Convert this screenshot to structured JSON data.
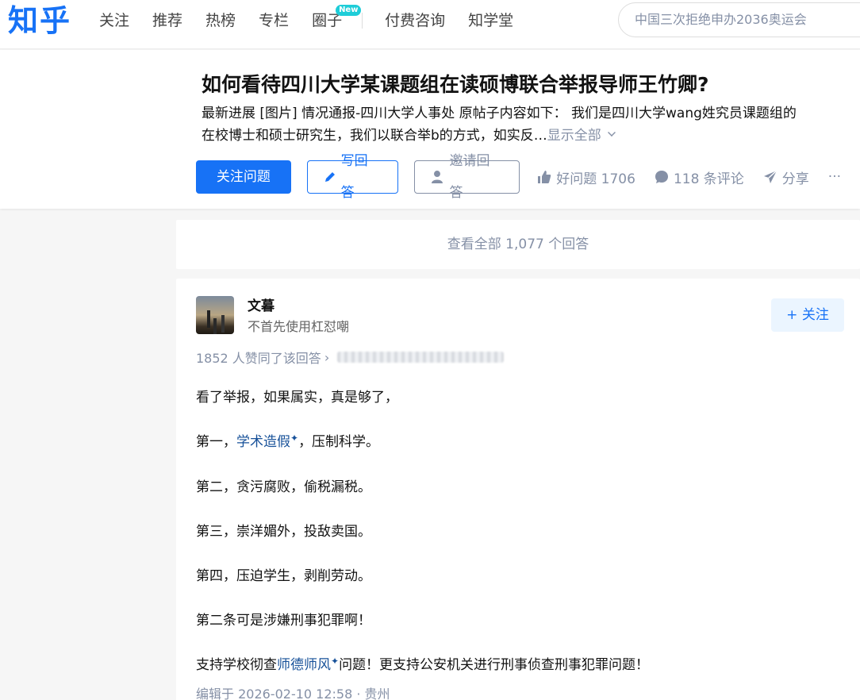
{
  "nav": {
    "logo": "知乎",
    "items": [
      "关注",
      "推荐",
      "热榜",
      "专栏",
      "圈子"
    ],
    "badge": "New",
    "items_right": [
      "付费咨询",
      "知学堂"
    ]
  },
  "search": {
    "placeholder": "中国三次拒绝申办2036奥运会"
  },
  "question": {
    "title": "如何看待四川大学某课题组在读硕博联合举报导师王竹卿?",
    "desc_line1": "最新进展 [图片] 情况通报-四川大学人事处 原帖子内容如下： 我们是四川大学wang姓究员课题组的",
    "desc_line2": "在校博士和硕士研究生，我们以联合举b的方式，如实反…",
    "show_all": "显示全部",
    "follow_label": "关注问题",
    "write_label": "写回答",
    "invite_label": "邀请回答",
    "good_label": "好问题 1706",
    "comments_label": "118 条评论",
    "share_label": "分享",
    "more_label": "···"
  },
  "view_all": "查看全部 1,077 个回答",
  "answer": {
    "author": "文暮",
    "bio": "不首先使用杠怼嘲",
    "follow_label": "+ 关注",
    "votes": "1852 人赞同了该回答",
    "paragraphs": {
      "p1": "看了举报，如果属实，真是够了，",
      "p2a": "第一，",
      "p2k": "学术造假",
      "p2b": "，压制科学。",
      "p3": "第二，贪污腐败，偷税漏税。",
      "p4": "第三，崇洋媚外，投敌卖国。",
      "p5": "第四，压迫学生，剥削劳动。",
      "p6": "第二条可是涉嫌刑事犯罪啊！",
      "p7a": "支持学校彻查",
      "p7k": "师德师风",
      "p7b": "问题！更支持公安机关进行刑事侦查刑事犯罪问题！"
    },
    "edit_meta": "编辑于 2026-02-10 12:58 · 贵州"
  },
  "colors": {
    "brand": "#1772f6",
    "muted": "#8590a6",
    "keyword": "#175199"
  },
  "icons": {
    "pencil": "pencil-icon",
    "invite": "invite-person-icon",
    "thumb": "thumbs-up-icon",
    "comment": "comment-bubble-icon",
    "share": "paper-plane-icon",
    "chevron": "chevron-down-icon",
    "arrow": "chevron-right-icon"
  }
}
